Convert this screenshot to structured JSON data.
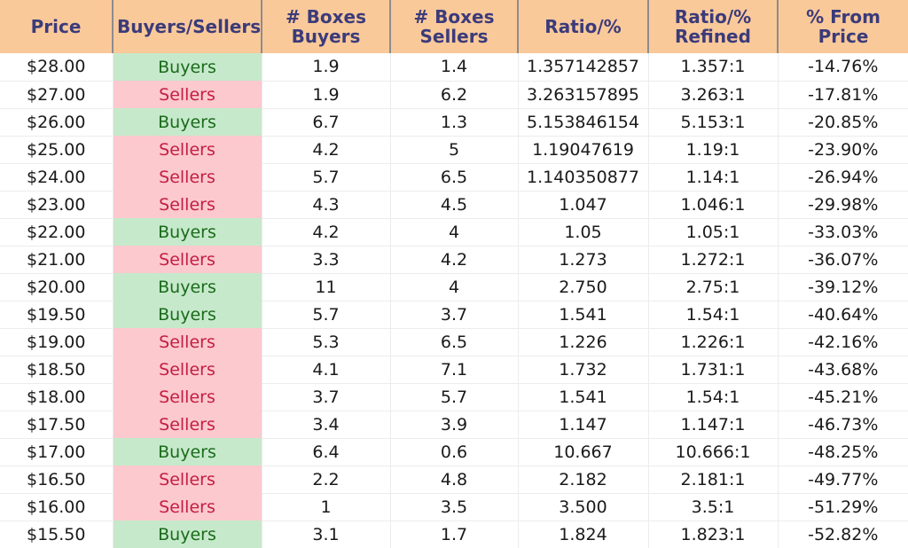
{
  "table": {
    "columns": [
      {
        "key": "price",
        "label": "Price",
        "name": "column-price"
      },
      {
        "key": "side",
        "label": "Buyers/Sellers",
        "name": "column-buyers-sellers"
      },
      {
        "key": "boxes_buyers",
        "label": "# Boxes\nBuyers",
        "name": "column-boxes-buyers"
      },
      {
        "key": "boxes_sellers",
        "label": "# Boxes\nSellers",
        "name": "column-boxes-sellers"
      },
      {
        "key": "ratio",
        "label": "Ratio/%",
        "name": "column-ratio"
      },
      {
        "key": "refined",
        "label": "Ratio/%\nRefined",
        "name": "column-ratio-refined"
      },
      {
        "key": "from_price",
        "label": "% From Price",
        "name": "column-percent-from-price"
      }
    ],
    "rows": [
      {
        "price": "$28.00",
        "side": "Buyers",
        "boxes_buyers": "1.9",
        "boxes_sellers": "1.4",
        "ratio": "1.357142857",
        "refined": "1.357:1",
        "from_price": "-14.76%"
      },
      {
        "price": "$27.00",
        "side": "Sellers",
        "boxes_buyers": "1.9",
        "boxes_sellers": "6.2",
        "ratio": "3.263157895",
        "refined": "3.263:1",
        "from_price": "-17.81%"
      },
      {
        "price": "$26.00",
        "side": "Buyers",
        "boxes_buyers": "6.7",
        "boxes_sellers": "1.3",
        "ratio": "5.153846154",
        "refined": "5.153:1",
        "from_price": "-20.85%"
      },
      {
        "price": "$25.00",
        "side": "Sellers",
        "boxes_buyers": "4.2",
        "boxes_sellers": "5",
        "ratio": "1.19047619",
        "refined": "1.19:1",
        "from_price": "-23.90%"
      },
      {
        "price": "$24.00",
        "side": "Sellers",
        "boxes_buyers": "5.7",
        "boxes_sellers": "6.5",
        "ratio": "1.140350877",
        "refined": "1.14:1",
        "from_price": "-26.94%"
      },
      {
        "price": "$23.00",
        "side": "Sellers",
        "boxes_buyers": "4.3",
        "boxes_sellers": "4.5",
        "ratio": "1.047",
        "refined": "1.046:1",
        "from_price": "-29.98%"
      },
      {
        "price": "$22.00",
        "side": "Buyers",
        "boxes_buyers": "4.2",
        "boxes_sellers": "4",
        "ratio": "1.05",
        "refined": "1.05:1",
        "from_price": "-33.03%"
      },
      {
        "price": "$21.00",
        "side": "Sellers",
        "boxes_buyers": "3.3",
        "boxes_sellers": "4.2",
        "ratio": "1.273",
        "refined": "1.272:1",
        "from_price": "-36.07%"
      },
      {
        "price": "$20.00",
        "side": "Buyers",
        "boxes_buyers": "11",
        "boxes_sellers": "4",
        "ratio": "2.750",
        "refined": "2.75:1",
        "from_price": "-39.12%"
      },
      {
        "price": "$19.50",
        "side": "Buyers",
        "boxes_buyers": "5.7",
        "boxes_sellers": "3.7",
        "ratio": "1.541",
        "refined": "1.54:1",
        "from_price": "-40.64%"
      },
      {
        "price": "$19.00",
        "side": "Sellers",
        "boxes_buyers": "5.3",
        "boxes_sellers": "6.5",
        "ratio": "1.226",
        "refined": "1.226:1",
        "from_price": "-42.16%"
      },
      {
        "price": "$18.50",
        "side": "Sellers",
        "boxes_buyers": "4.1",
        "boxes_sellers": "7.1",
        "ratio": "1.732",
        "refined": "1.731:1",
        "from_price": "-43.68%"
      },
      {
        "price": "$18.00",
        "side": "Sellers",
        "boxes_buyers": "3.7",
        "boxes_sellers": "5.7",
        "ratio": "1.541",
        "refined": "1.54:1",
        "from_price": "-45.21%"
      },
      {
        "price": "$17.50",
        "side": "Sellers",
        "boxes_buyers": "3.4",
        "boxes_sellers": "3.9",
        "ratio": "1.147",
        "refined": "1.147:1",
        "from_price": "-46.73%"
      },
      {
        "price": "$17.00",
        "side": "Buyers",
        "boxes_buyers": "6.4",
        "boxes_sellers": "0.6",
        "ratio": "10.667",
        "refined": "10.666:1",
        "from_price": "-48.25%"
      },
      {
        "price": "$16.50",
        "side": "Sellers",
        "boxes_buyers": "2.2",
        "boxes_sellers": "4.8",
        "ratio": "2.182",
        "refined": "2.181:1",
        "from_price": "-49.77%"
      },
      {
        "price": "$16.00",
        "side": "Sellers",
        "boxes_buyers": "1",
        "boxes_sellers": "3.5",
        "ratio": "3.500",
        "refined": "3.5:1",
        "from_price": "-51.29%"
      },
      {
        "price": "$15.50",
        "side": "Buyers",
        "boxes_buyers": "3.1",
        "boxes_sellers": "1.7",
        "ratio": "1.824",
        "refined": "1.823:1",
        "from_price": "-52.82%"
      }
    ]
  },
  "colors": {
    "header_bg": "#fac99a",
    "header_text": "#3b3b7a",
    "buyers_bg": "#c6e9cb",
    "buyers_text": "#1a6b1a",
    "sellers_bg": "#fbc9ce",
    "sellers_text": "#c41e42",
    "grid_line": "#ececec",
    "header_divider": "#8c8c8c"
  }
}
